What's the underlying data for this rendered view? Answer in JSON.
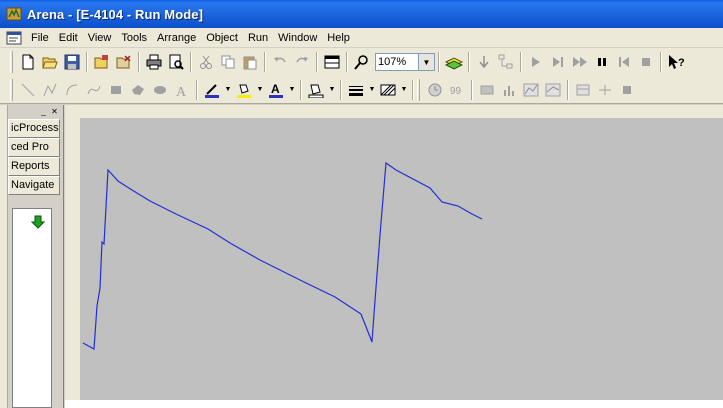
{
  "window": {
    "title": "Arena - [E-4104 - Run Mode]",
    "icon": "arena-app-icon"
  },
  "menu": {
    "system_icon": "document-icon",
    "items": [
      "File",
      "Edit",
      "View",
      "Tools",
      "Arrange",
      "Object",
      "Run",
      "Window",
      "Help"
    ]
  },
  "toolbar_standard": {
    "zoom_value": "107%"
  },
  "left_panel": {
    "tabs": [
      "icProcess",
      "ced Pro",
      "Reports",
      "Navigate"
    ]
  },
  "plot": {
    "background": "#c0c0c0",
    "line_color": "#2030d0",
    "type": "line"
  },
  "colors": {
    "titlebar": "#0a5fe2",
    "chrome": "#ece9d8"
  }
}
